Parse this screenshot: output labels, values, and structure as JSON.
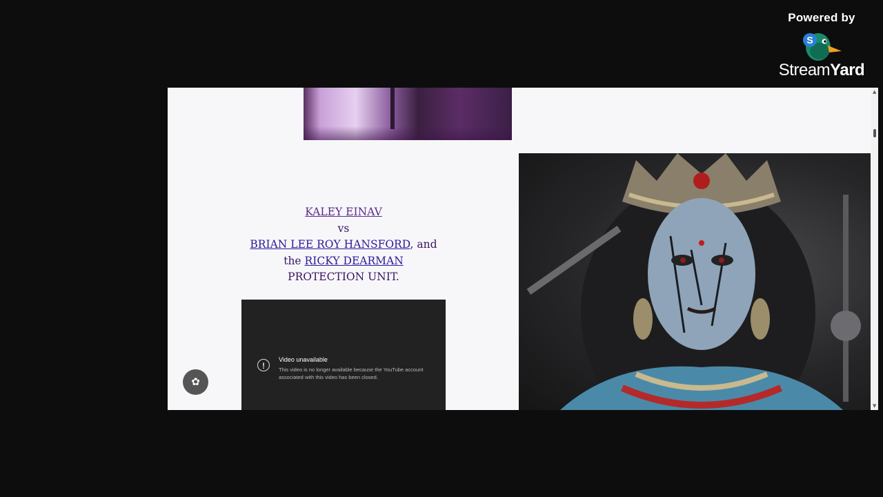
{
  "branding": {
    "powered_by": "Powered by",
    "name_regular": "Stream",
    "name_bold": "Yard",
    "logo_badge": "S"
  },
  "webpage": {
    "title_line1": "KALEY EINAV",
    "title_vs": "vs",
    "person2": "BRIAN LEE ROY HANSFORD",
    "connector": ", and",
    "the_word": "the",
    "person3": "RICKY DEARMAN",
    "unit": "PROTECTION UNIT.",
    "video": {
      "title": "Video unavailable",
      "message": "This video is no longer available because the YouTube account associated with this video has been closed."
    },
    "cookie_icon": "cookie-icon"
  },
  "colors": {
    "background": "#0d0d0d",
    "page": "#f7f7fa",
    "title_text": "#3a1560",
    "link": "#2b1a9a",
    "video_bg": "#222222"
  }
}
